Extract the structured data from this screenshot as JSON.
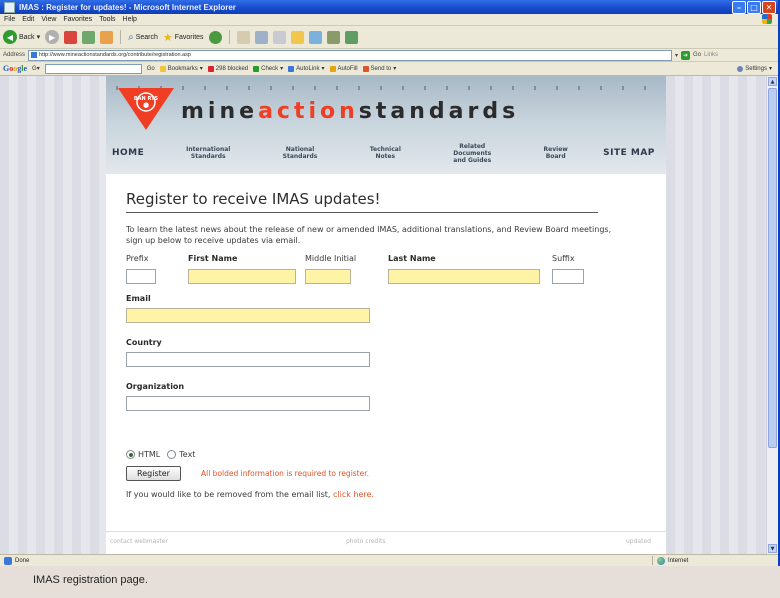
{
  "window": {
    "title": "IMAS : Register for updates! - Microsoft Internet Explorer"
  },
  "menu": [
    "File",
    "Edit",
    "View",
    "Favorites",
    "Tools",
    "Help"
  ],
  "toolbar": {
    "back": "Back",
    "search": "Search",
    "favorites": "Favorites"
  },
  "address": {
    "label": "Address",
    "url": "http://www.mineactionstandards.org/contribute/registration.asp",
    "go": "Go",
    "links": "Links"
  },
  "google_bar": {
    "logo": [
      "G",
      "o",
      "o",
      "g",
      "l",
      "e"
    ],
    "go_label": "Go",
    "items": [
      "Bookmarks",
      "298 blocked",
      "Check",
      "AutoLink",
      "AutoFill",
      "Send to"
    ],
    "settings": "Settings"
  },
  "site": {
    "logo_parts": [
      "mine",
      "action",
      "standards"
    ],
    "badge_text": "BAN RTS",
    "nav": {
      "home": "HOME",
      "international": "International\nStandards",
      "national": "National\nStandards",
      "technical": "Technical\nNotes",
      "related": "Related\nDocuments\nand Guides",
      "review": "Review\nBoard",
      "sitemap": "SITE MAP"
    }
  },
  "form": {
    "title": "Register to receive IMAS updates!",
    "intro": "To learn the latest news about the release of new or amended IMAS, additional translations, and Review Board meetings, sign up below to receive updates via email.",
    "labels": {
      "prefix": "Prefix",
      "first_name": "First Name",
      "middle_initial": "Middle Initial",
      "last_name": "Last Name",
      "suffix": "Suffix",
      "email": "Email",
      "country": "Country",
      "organization": "Organization"
    },
    "format_options": {
      "html": "HTML",
      "text": "Text",
      "selected": "HTML"
    },
    "register_button": "Register",
    "required_note": "All bolded information is required to register.",
    "remove_prefix": "If you would like to be removed from the email list, ",
    "remove_link": "click here.",
    "footer_left": "contact webmaster",
    "footer_mid": "photo credits",
    "footer_right": "updated"
  },
  "status": {
    "left": "Done",
    "zone": "Internet"
  },
  "caption": "IMAS registration page.",
  "colors": {
    "accent_red": "#ef3e23",
    "required_yellow": "#fff3a6",
    "xp_blue": "#1a4fd0"
  }
}
